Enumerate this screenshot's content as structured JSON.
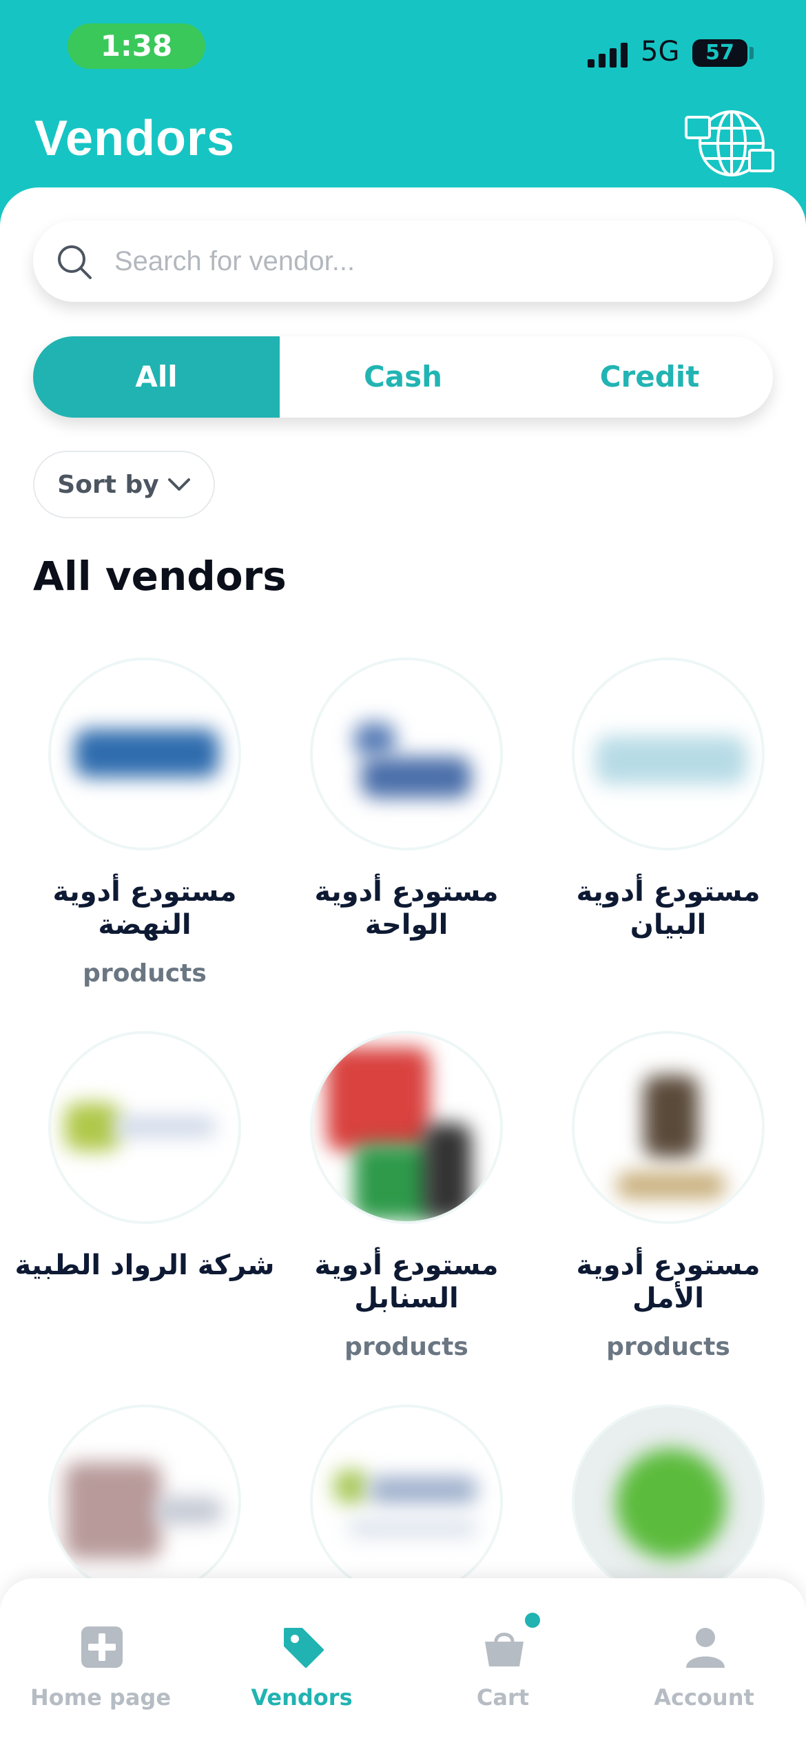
{
  "status_bar": {
    "time": "1:38",
    "network": "5G",
    "battery": "57"
  },
  "header": {
    "title": "Vendors",
    "language_icon": "globe-language-icon"
  },
  "search": {
    "placeholder": "Search for vendor..."
  },
  "filters": {
    "tabs": [
      "All",
      "Cash",
      "Credit"
    ],
    "active": "All"
  },
  "sort": {
    "label": "Sort by"
  },
  "section": {
    "title": "All vendors"
  },
  "vendors": [
    {
      "name": "مستودع أدوية النهضة",
      "sub": "products"
    },
    {
      "name": "مستودع أدوية الواحة",
      "sub": ""
    },
    {
      "name": "مستودع أدوية البيان",
      "sub": ""
    },
    {
      "name": "شركة الرواد الطبية",
      "sub": ""
    },
    {
      "name": "مستودع أدوية السنابل",
      "sub": "products"
    },
    {
      "name": "مستودع أدوية الأمل",
      "sub": "products"
    }
  ],
  "bottom_nav": [
    {
      "label": "Home page",
      "icon": "plus-square-icon"
    },
    {
      "label": "Vendors",
      "icon": "tag-icon"
    },
    {
      "label": "Cart",
      "icon": "basket-icon"
    },
    {
      "label": "Account",
      "icon": "person-icon"
    }
  ],
  "colors": {
    "primary": "#16c5c3",
    "accent": "#20b3b1",
    "muted": "#b6bcc3"
  }
}
